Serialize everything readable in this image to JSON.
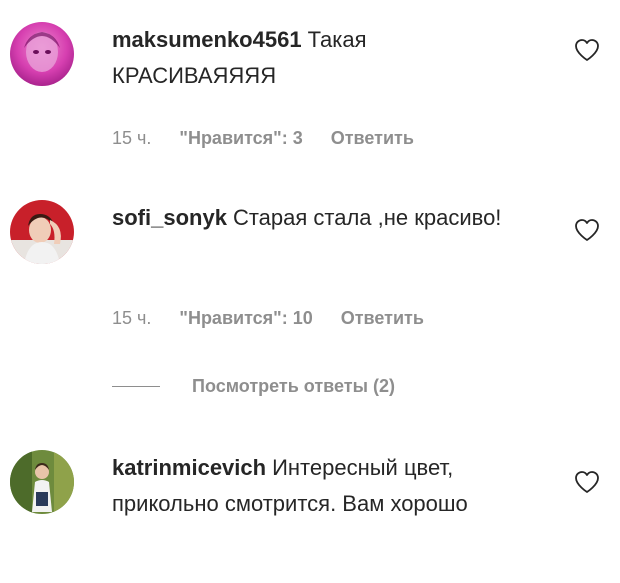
{
  "comments": [
    {
      "username": "maksumenko4561",
      "text": "Такая КРАСИВАЯЯЯЯ",
      "time": "15 ч.",
      "likes": "\"Нравится\": 3",
      "reply": "Ответить",
      "avatar_icon": "user-avatar-pink",
      "like_icon": "heart-outline-icon"
    },
    {
      "username": "sofi_sonyk",
      "text": "Старая стала ,не красиво!",
      "time": "15 ч.",
      "likes": "\"Нравится\": 10",
      "reply": "Ответить",
      "avatar_icon": "user-avatar-red",
      "like_icon": "heart-outline-icon",
      "view_replies": "Посмотреть ответы (2)"
    },
    {
      "username": "katrinmicevich",
      "text": "Интересный цвет, прикольно смотрится. Вам хорошо",
      "avatar_icon": "user-avatar-green",
      "like_icon": "heart-outline-icon"
    }
  ],
  "colors": {
    "text": "#262626",
    "secondary": "#8e8e8e",
    "background": "#ffffff"
  }
}
